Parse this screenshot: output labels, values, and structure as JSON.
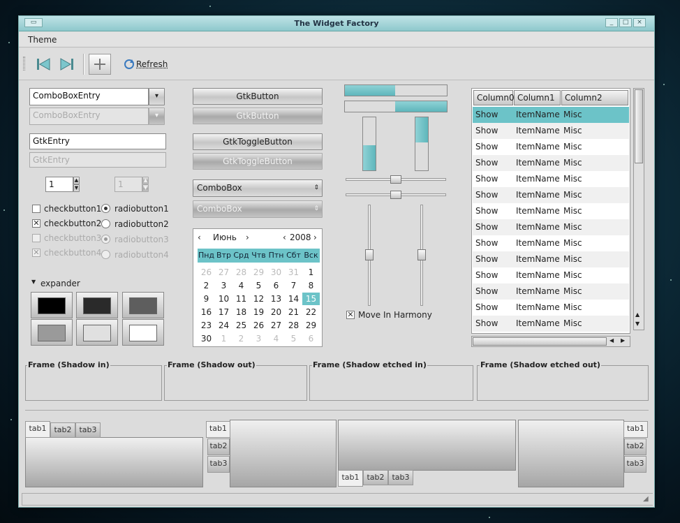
{
  "window": {
    "title": "The Widget Factory"
  },
  "menu": {
    "theme": "Theme"
  },
  "toolbar": {
    "refresh": "Refresh"
  },
  "left": {
    "combo_entry": "ComboBoxEntry",
    "combo_entry_disabled": "ComboBoxEntry",
    "entry": "GtkEntry",
    "entry_disabled": "GtkEntry",
    "spin1": "1",
    "spin2": "1",
    "check1": "checkbutton1",
    "check2": "checkbutton2",
    "check3": "checkbutton3",
    "check4": "checkbutton4",
    "radio1": "radiobutton1",
    "radio2": "radiobutton2",
    "radio3": "radiobutton3",
    "radio4": "radiobutton4",
    "expander": "expander",
    "swatch_colors": [
      "#000000",
      "#2a2a2a",
      "#5e5e5e",
      "#9a9a9a",
      "#e0e0e0",
      "#ffffff"
    ]
  },
  "buttons": {
    "button": "GtkButton",
    "button_disabled": "GtkButton",
    "toggle": "GtkToggleButton",
    "toggle_disabled": "GtkToggleButton",
    "combo": "ComboBox",
    "combo_disabled": "ComboBox"
  },
  "calendar": {
    "month": "Июнь",
    "year": "2008",
    "weekdays": [
      "Пнд",
      "Втр",
      "Срд",
      "Чтв",
      "Птн",
      "Сбт",
      "Вск"
    ],
    "selected": "15",
    "rows": [
      [
        "26",
        "27",
        "28",
        "29",
        "30",
        "31",
        "1"
      ],
      [
        "2",
        "3",
        "4",
        "5",
        "6",
        "7",
        "8"
      ],
      [
        "9",
        "10",
        "11",
        "12",
        "13",
        "14",
        "15"
      ],
      [
        "16",
        "17",
        "18",
        "19",
        "20",
        "21",
        "22"
      ],
      [
        "23",
        "24",
        "25",
        "26",
        "27",
        "28",
        "29"
      ],
      [
        "30",
        "1",
        "2",
        "3",
        "4",
        "5",
        "6"
      ]
    ]
  },
  "sliders": {
    "move_in_harmony": "Move In Harmony"
  },
  "tree": {
    "columns": [
      "Column0",
      "Column1",
      "Column2"
    ],
    "rows": [
      [
        "Show",
        "ItemName",
        "Misc"
      ],
      [
        "Show",
        "ItemName",
        "Misc"
      ],
      [
        "Show",
        "ItemName",
        "Misc"
      ],
      [
        "Show",
        "ItemName",
        "Misc"
      ],
      [
        "Show",
        "ItemName",
        "Misc"
      ],
      [
        "Show",
        "ItemName",
        "Misc"
      ],
      [
        "Show",
        "ItemName",
        "Misc"
      ],
      [
        "Show",
        "ItemName",
        "Misc"
      ],
      [
        "Show",
        "ItemName",
        "Misc"
      ],
      [
        "Show",
        "ItemName",
        "Misc"
      ],
      [
        "Show",
        "ItemName",
        "Misc"
      ],
      [
        "Show",
        "ItemName",
        "Misc"
      ],
      [
        "Show",
        "ItemName",
        "Misc"
      ],
      [
        "Show",
        "ItemName",
        "Misc"
      ]
    ]
  },
  "frames": [
    "Frame (Shadow in)",
    "Frame (Shadow out)",
    "Frame (Shadow etched in)",
    "Frame (Shadow etched out)"
  ],
  "tabs": [
    "tab1",
    "tab2",
    "tab3"
  ],
  "colors": {
    "accent": "#6cc3c8",
    "title_bar": "#9fd2d6"
  }
}
